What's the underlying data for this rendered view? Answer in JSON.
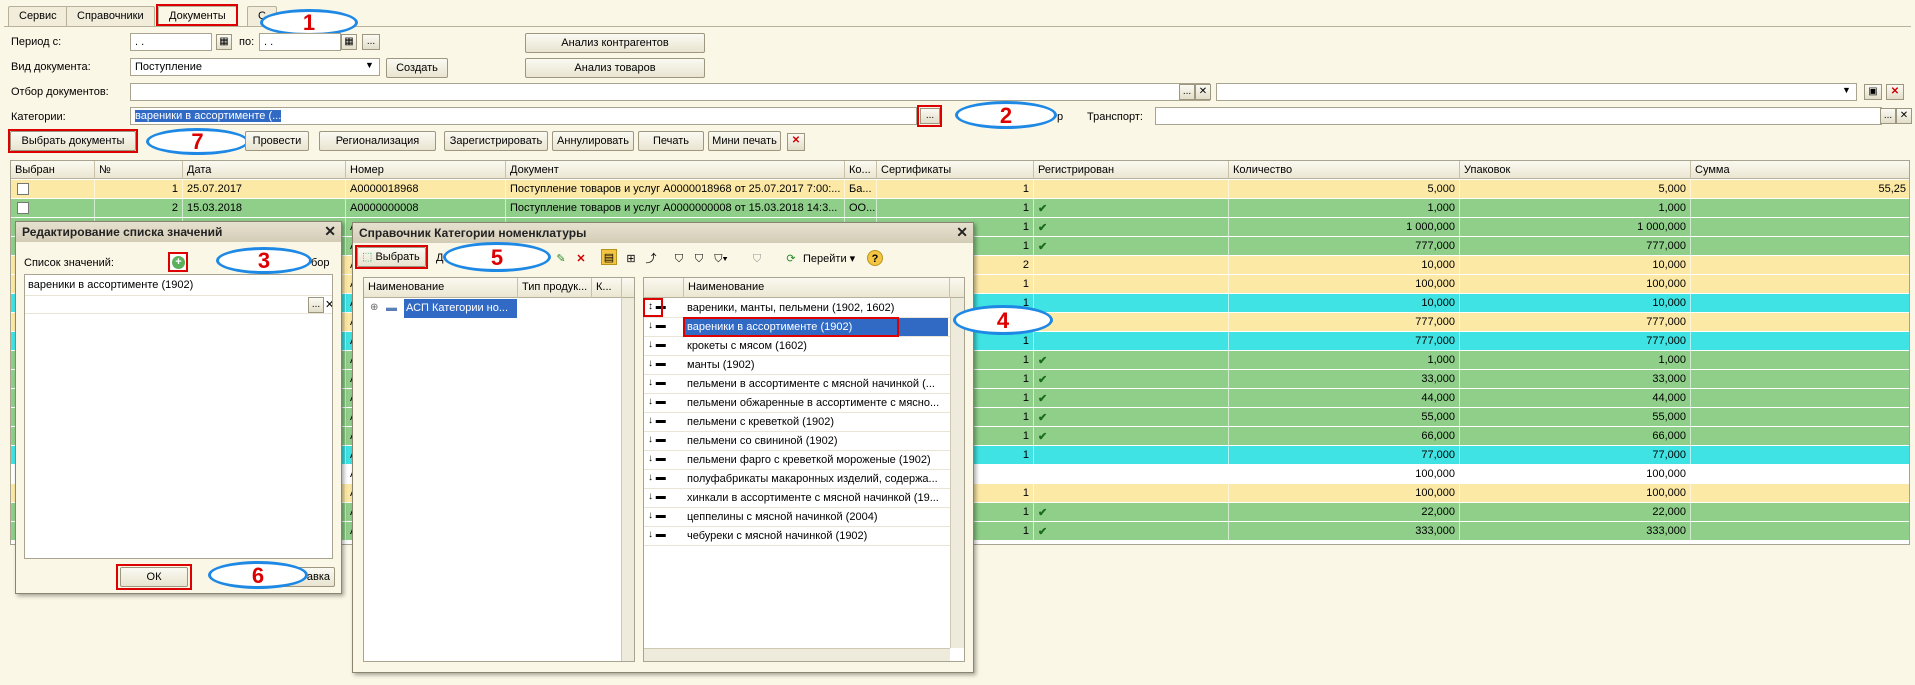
{
  "tabs": [
    "Сервис",
    "Справочники",
    "Документы",
    "С"
  ],
  "annotations": {
    "n1": "1",
    "n2": "2",
    "n3": "3",
    "n4": "4",
    "n5": "5",
    "n6": "6",
    "n7": "7"
  },
  "filters": {
    "period_from_label": "Период с:",
    "period_from_value": " .  .",
    "period_to_label": "по:",
    "period_to_value": " .  .",
    "doc_type_label": "Вид документа:",
    "doc_type_value": "Поступление",
    "create_button": "Создать",
    "doc_filter_label": "Отбор документов:",
    "categories_label": "Категории:",
    "categories_value": "вареники в ассортименте (...",
    "transport_label": "Транспорт:",
    "partial_label": "р",
    "analysis_contractors": "Анализ контрагентов",
    "analysis_goods": "Анализ товаров"
  },
  "toolbar": {
    "select_docs": "Выбрать документы",
    "post": "Провести",
    "regionalization": "Регионализация",
    "register": "Зарегистрировать",
    "annul": "Аннулировать",
    "print": "Печать",
    "mini_print": "Мини печать"
  },
  "grid": {
    "headers": [
      "Выбран",
      "№",
      "Дата",
      "Номер",
      "Документ",
      "Ко...",
      "Сертификаты",
      "Регистрирован",
      "Количество",
      "Упаковок",
      "Сумма"
    ],
    "rows": [
      {
        "n": "1",
        "date": "25.07.2017",
        "num": "А0000018968",
        "doc": "Поступление товаров и услуг А0000018968 от 25.07.2017 7:00:...",
        "ko": "Ба...",
        "cert": "1",
        "reg": "",
        "qty": "5,000",
        "pack": "5,000",
        "sum": "55,25"
      },
      {
        "n": "2",
        "date": "15.03.2018",
        "num": "А0000000008",
        "doc": "Поступление товаров и услуг А0000000008 от 15.03.2018 14:3...",
        "ko": "ОО...",
        "cert": "1",
        "reg": "✔",
        "qty": "1,000",
        "pack": "1,000",
        "sum": ""
      },
      {
        "cert": "1",
        "reg": "✔",
        "qty": "1 000,000",
        "pack": "1 000,000"
      },
      {
        "cert": "1",
        "reg": "✔",
        "qty": "777,000",
        "pack": "777,000"
      },
      {
        "cert": "2",
        "reg": "",
        "qty": "10,000",
        "pack": "10,000"
      },
      {
        "cert": "1",
        "reg": "",
        "qty": "100,000",
        "pack": "100,000"
      },
      {
        "cert": "1",
        "reg": "",
        "qty": "10,000",
        "pack": "10,000"
      },
      {
        "cert": "1",
        "reg": "",
        "qty": "777,000",
        "pack": "777,000"
      },
      {
        "cert": "1",
        "reg": "",
        "qty": "777,000",
        "pack": "777,000"
      },
      {
        "cert": "1",
        "reg": "✔",
        "qty": "1,000",
        "pack": "1,000"
      },
      {
        "cert": "1",
        "reg": "✔",
        "qty": "33,000",
        "pack": "33,000"
      },
      {
        "cert": "1",
        "reg": "✔",
        "qty": "44,000",
        "pack": "44,000"
      },
      {
        "cert": "1",
        "reg": "✔",
        "qty": "55,000",
        "pack": "55,000"
      },
      {
        "cert": "1",
        "reg": "✔",
        "qty": "66,000",
        "pack": "66,000"
      },
      {
        "cert": "1",
        "reg": "",
        "qty": "77,000",
        "pack": "77,000"
      },
      {
        "cert": "",
        "reg": "",
        "qty": "100,000",
        "pack": "100,000"
      },
      {
        "cert": "1",
        "reg": "",
        "qty": "100,000",
        "pack": "100,000"
      },
      {
        "cert": "1",
        "reg": "✔",
        "qty": "22,000",
        "pack": "22,000"
      },
      {
        "cert": "1",
        "reg": "✔",
        "qty": "333,000",
        "pack": "333,000"
      }
    ],
    "row_colors": [
      "#fde9a6",
      "#8fcf8a",
      "#8fcf8a",
      "#8fcf8a",
      "#fde9a6",
      "#fde9a6",
      "#3fe3e3",
      "#fde9a6",
      "#3fe3e3",
      "#8fcf8a",
      "#8fcf8a",
      "#8fcf8a",
      "#8fcf8a",
      "#8fcf8a",
      "#3fe3e3",
      "#ffffff",
      "#fde9a6",
      "#8fcf8a",
      "#8fcf8a"
    ],
    "partial_prefix": "А("
  },
  "value_list_dialog": {
    "title": "Редактирование списка значений",
    "list_label": "Список значений:",
    "partial_text": "бор",
    "item": "вареники в ассортименте (1902)",
    "ok": "ОК",
    "partial_button": "авка"
  },
  "category_dialog": {
    "title": "Справочник Категории номенклатуры",
    "select_button": "Выбрать",
    "partial_text": "Д",
    "goto": "Перейти",
    "left_headers": [
      "Наименование",
      "Тип продук...",
      "К..."
    ],
    "left_item": "АСП Категории но...",
    "right_header": "Наименование",
    "items": [
      "вареники, манты, пельмени (1902, 1602)",
      "вареники в ассортименте (1902)",
      "крокеты с мясом (1602)",
      "манты (1902)",
      "пельмени в ассортименте с мясной начинкой (...",
      "пельмени обжаренные в ассортименте с мясно...",
      "пельмени с креветкой (1902)",
      "пельмени со свининой (1902)",
      "пельмени фарго с креветкой мороженые (1902)",
      "полуфабрикаты макаронных изделий, содержа...",
      "хинкали в ассортименте с мясной начинкой (19...",
      "цеппелины с мясной начинкой (2004)",
      "чебуреки с мясной начинкой (1902)"
    ]
  }
}
